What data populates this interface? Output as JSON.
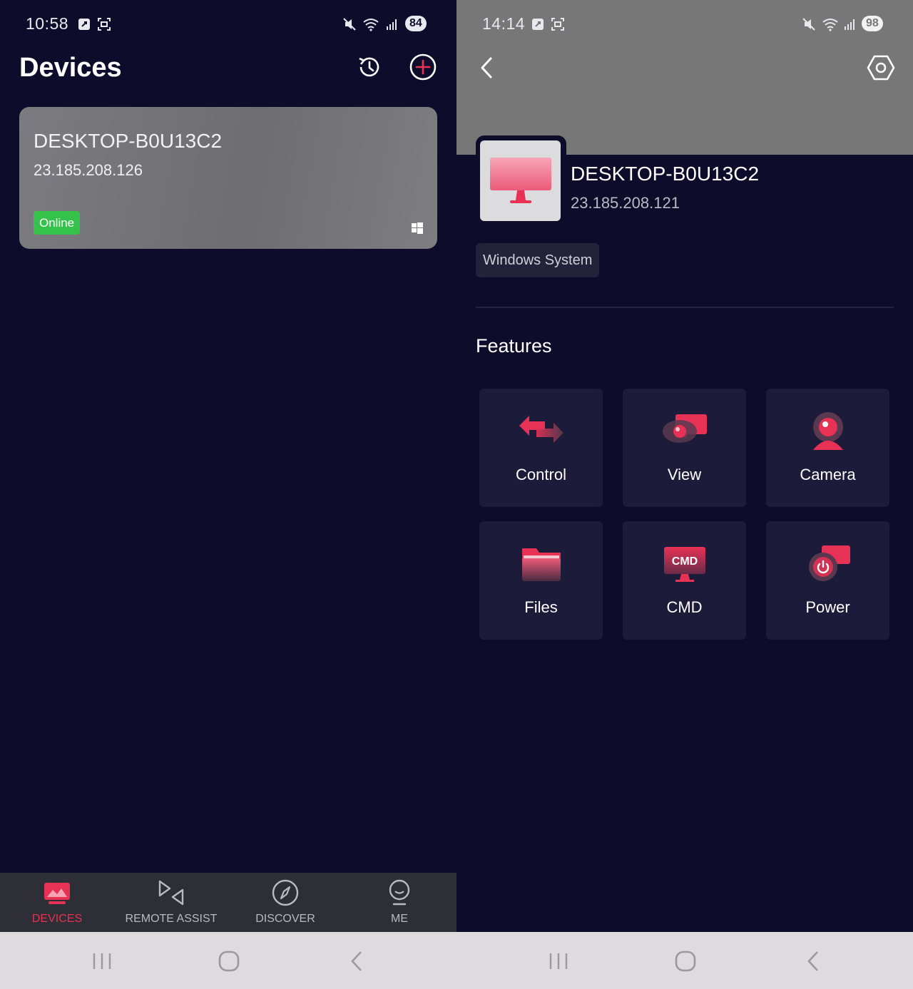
{
  "colors": {
    "accent": "#e83255",
    "online": "#35c24a",
    "background": "#0d0d2b",
    "card": "#1c1c3a"
  },
  "left": {
    "status": {
      "time": "10:58",
      "battery": "84"
    },
    "title": "Devices",
    "header_icons": [
      "history-icon",
      "add-icon"
    ],
    "device": {
      "name": "DESKTOP-B0U13C2",
      "ip": "23.185.208.126",
      "status": "Online",
      "os_icon": "windows-icon"
    },
    "tabs": [
      {
        "label": "DEVICES",
        "icon": "devices-icon",
        "active": true
      },
      {
        "label": "REMOTE ASSIST",
        "icon": "remote-assist-icon",
        "active": false
      },
      {
        "label": "DISCOVER",
        "icon": "compass-icon",
        "active": false
      },
      {
        "label": "ME",
        "icon": "profile-icon",
        "active": false
      }
    ]
  },
  "right": {
    "status": {
      "time": "14:14",
      "battery": "98"
    },
    "device": {
      "name": "DESKTOP-B0U13C2",
      "ip": "23.185.208.121"
    },
    "os_tag": "Windows System",
    "features_title": "Features",
    "features": [
      {
        "label": "Control",
        "icon": "control-icon"
      },
      {
        "label": "View",
        "icon": "view-icon"
      },
      {
        "label": "Camera",
        "icon": "camera-icon"
      },
      {
        "label": "Files",
        "icon": "folder-icon"
      },
      {
        "label": "CMD",
        "icon": "cmd-icon",
        "icon_text": "CMD"
      },
      {
        "label": "Power",
        "icon": "power-icon"
      }
    ]
  },
  "system_nav": [
    "recent-apps-icon",
    "home-icon",
    "back-icon"
  ]
}
